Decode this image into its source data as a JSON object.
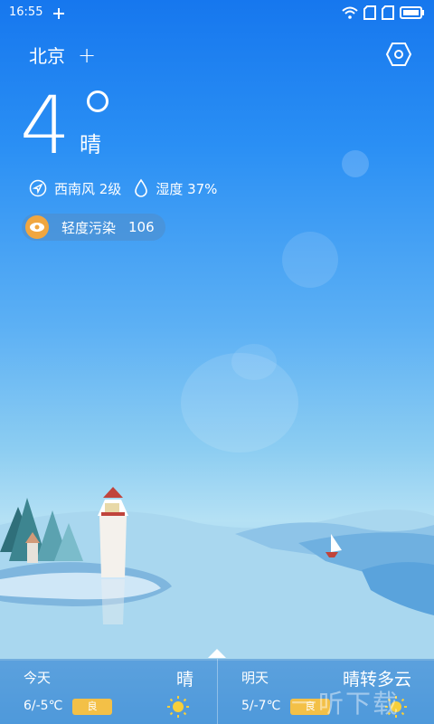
{
  "status_bar": {
    "time": "16:55"
  },
  "header": {
    "city": "北京",
    "add_label": "+"
  },
  "current": {
    "temperature": "4",
    "condition": "晴",
    "wind": "西南风 2级",
    "humidity": "湿度 37%"
  },
  "aqi": {
    "label": "轻度污染",
    "value": "106"
  },
  "forecast": [
    {
      "day": "今天",
      "condition": "晴",
      "range": "6/-5℃",
      "quality": "良"
    },
    {
      "day": "明天",
      "condition": "晴转多云",
      "range": "5/-7℃",
      "quality": "良"
    }
  ],
  "watermark": "一听下载",
  "colors": {
    "accent": "#f0a640",
    "badge": "#f3c047"
  }
}
